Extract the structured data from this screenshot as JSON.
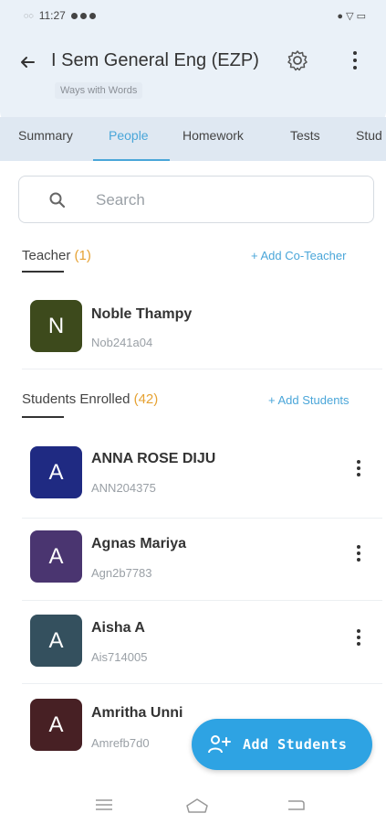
{
  "status": {
    "time": "11:27",
    "signal": "◌◌",
    "right_text": "● ▽ ▭"
  },
  "header": {
    "title": "I Sem General Eng (EZP)",
    "subtitle": "Ways with Words"
  },
  "tabs": [
    {
      "label": "Summary"
    },
    {
      "label": "People"
    },
    {
      "label": "Homework"
    },
    {
      "label": "Tests"
    },
    {
      "label": "Stud"
    }
  ],
  "search": {
    "placeholder": "Search",
    "value": ""
  },
  "teacher_section": {
    "title": "Teacher",
    "count": "(1)",
    "action": "+ Add Co-Teacher"
  },
  "teacher": {
    "initial": "N",
    "name": "Noble  Thampy",
    "id": "Nob241a04",
    "color": "#3d4a1c"
  },
  "students_section": {
    "title": "Students Enrolled",
    "count": "(42)",
    "action": "+ Add Students"
  },
  "students": [
    {
      "initial": "A",
      "name": "ANNA ROSE DIJU",
      "id": "ANN204375",
      "color": "#1f2a82"
    },
    {
      "initial": "A",
      "name": "Agnas Mariya",
      "id": "Agn2b7783",
      "color": "#4a3570"
    },
    {
      "initial": "A",
      "name": "Aisha A",
      "id": "Ais714005",
      "color": "#34505e"
    },
    {
      "initial": "A",
      "name": "Amritha Unni",
      "id": "Amrefb7d0",
      "color": "#472024"
    }
  ],
  "fab": {
    "label": "Add Students"
  },
  "colors": {
    "accent": "#2ea3e3",
    "link": "#4aa6d9",
    "count": "#e6a233",
    "header_bg": "#eaf1f8"
  }
}
